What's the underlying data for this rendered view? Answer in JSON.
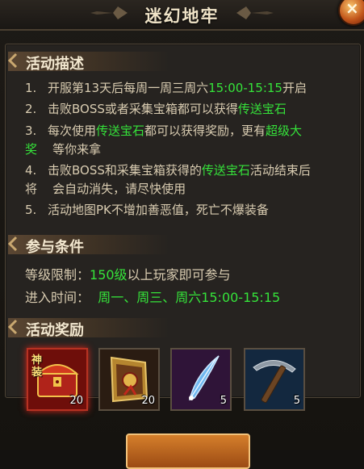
{
  "window": {
    "title": "迷幻地牢",
    "close_label": "×"
  },
  "sections": {
    "desc": {
      "title": "活动描述"
    },
    "cond": {
      "title": "参与条件"
    },
    "reward": {
      "title": "活动奖励"
    }
  },
  "desc_lines": [
    {
      "num": "1.",
      "segs": [
        "开服第13天后每周一周三周六",
        "15:00-15:15",
        "开启"
      ]
    },
    {
      "num": "2.",
      "segs": [
        "击败BOSS或者采集宝箱都可以获得",
        "传送宝石",
        ""
      ]
    },
    {
      "num": "3.",
      "segs": [
        "每次使用",
        "传送宝石",
        "都可以获得奖励，更有",
        "超级大"
      ]
    },
    {
      "num": "",
      "segs": [
        "",
        "奖",
        "    等你来拿"
      ]
    },
    {
      "num": "4.",
      "segs": [
        "击败BOSS和采集宝箱获得的",
        "传送宝石",
        "活动结束后"
      ]
    },
    {
      "num": "",
      "segs": [
        "将    会自动消失，请尽快使用"
      ]
    },
    {
      "num": "5.",
      "segs": [
        "活动地图PK不增加善恶值，死亡不爆装备"
      ]
    }
  ],
  "conditions": {
    "level_label": "等级限制：",
    "level_value": "150级",
    "level_suffix": "以上玩家即可参与",
    "time_label": "进入时间：",
    "time_value": "周一、周三、周六15:00-15:15"
  },
  "rewards": [
    {
      "icon": "divine-chest-icon",
      "count": "20",
      "badge": "神装"
    },
    {
      "icon": "golden-scroll-icon",
      "count": "20"
    },
    {
      "icon": "blue-feather-icon",
      "count": "5"
    },
    {
      "icon": "pickaxe-icon",
      "count": "5"
    }
  ],
  "colors": {
    "highlight": "#35e33a",
    "text": "#d9ccb1",
    "title": "#f0e4c8"
  }
}
